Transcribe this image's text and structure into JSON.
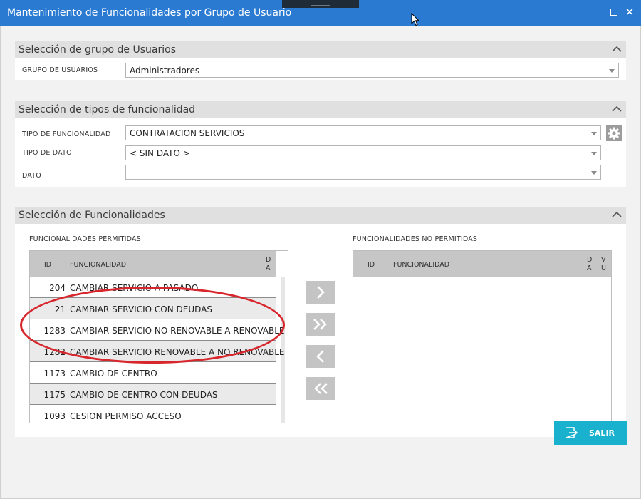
{
  "window": {
    "title": "Mantenimiento de Funcionalidades por Grupo de Usuario",
    "close_glyph": "✕"
  },
  "group_section": {
    "title": "Selección de grupo de Usuarios",
    "user_group_label": "GRUPO DE USUARIOS",
    "user_group_value": "Administradores"
  },
  "types_section": {
    "title": "Selección de tipos de funcionalidad",
    "func_type_label": "TIPO DE FUNCIONALIDAD",
    "func_type_value": "CONTRATACION SERVICIOS",
    "data_type_label": "TIPO DE DATO",
    "data_type_value": "< SIN DATO >",
    "data_label": "DATO",
    "data_value": ""
  },
  "functions_section": {
    "title": "Selección de Funcionalidades",
    "allowed": {
      "title": "FUNCIONALIDADES PERMITIDAS",
      "columns": {
        "id": "ID",
        "name": "FUNCIONALIDAD",
        "da_line1": "D",
        "da_line2": "A"
      },
      "rows": [
        {
          "id": "204",
          "name": "CAMBIAR SERVICIO A PASADO"
        },
        {
          "id": "21",
          "name": "CAMBIAR SERVICIO CON DEUDAS"
        },
        {
          "id": "1283",
          "name": "CAMBIAR SERVICIO NO RENOVABLE A RENOVABLE"
        },
        {
          "id": "1282",
          "name": "CAMBIAR SERVICIO RENOVABLE A NO RENOVABLE"
        },
        {
          "id": "1173",
          "name": "CAMBIO DE CENTRO"
        },
        {
          "id": "1175",
          "name": "CAMBIO DE CENTRO CON DEUDAS"
        },
        {
          "id": "1093",
          "name": "CESION PERMISO ACCESO"
        }
      ]
    },
    "denied": {
      "title": "FUNCIONALIDADES NO PERMITIDAS",
      "columns": {
        "id": "ID",
        "name": "FUNCIONALIDAD",
        "d_line1": "D",
        "d_line2": "A",
        "v_line1": "V",
        "v_line2": "U"
      },
      "rows": []
    }
  },
  "actions": {
    "exit_label": "SALIR"
  },
  "icons": {
    "collapse": "chevron-up-icon",
    "settings": "gear-icon",
    "move_right": "chevron-right-icon",
    "move_all_right": "double-chevron-right-icon",
    "move_left": "chevron-left-icon",
    "move_all_left": "double-chevron-left-icon",
    "exit": "exit-icon"
  },
  "colors": {
    "titlebar": "#2a7ad2",
    "exit_button": "#1ab1cf",
    "annotation": "#d7262c"
  }
}
